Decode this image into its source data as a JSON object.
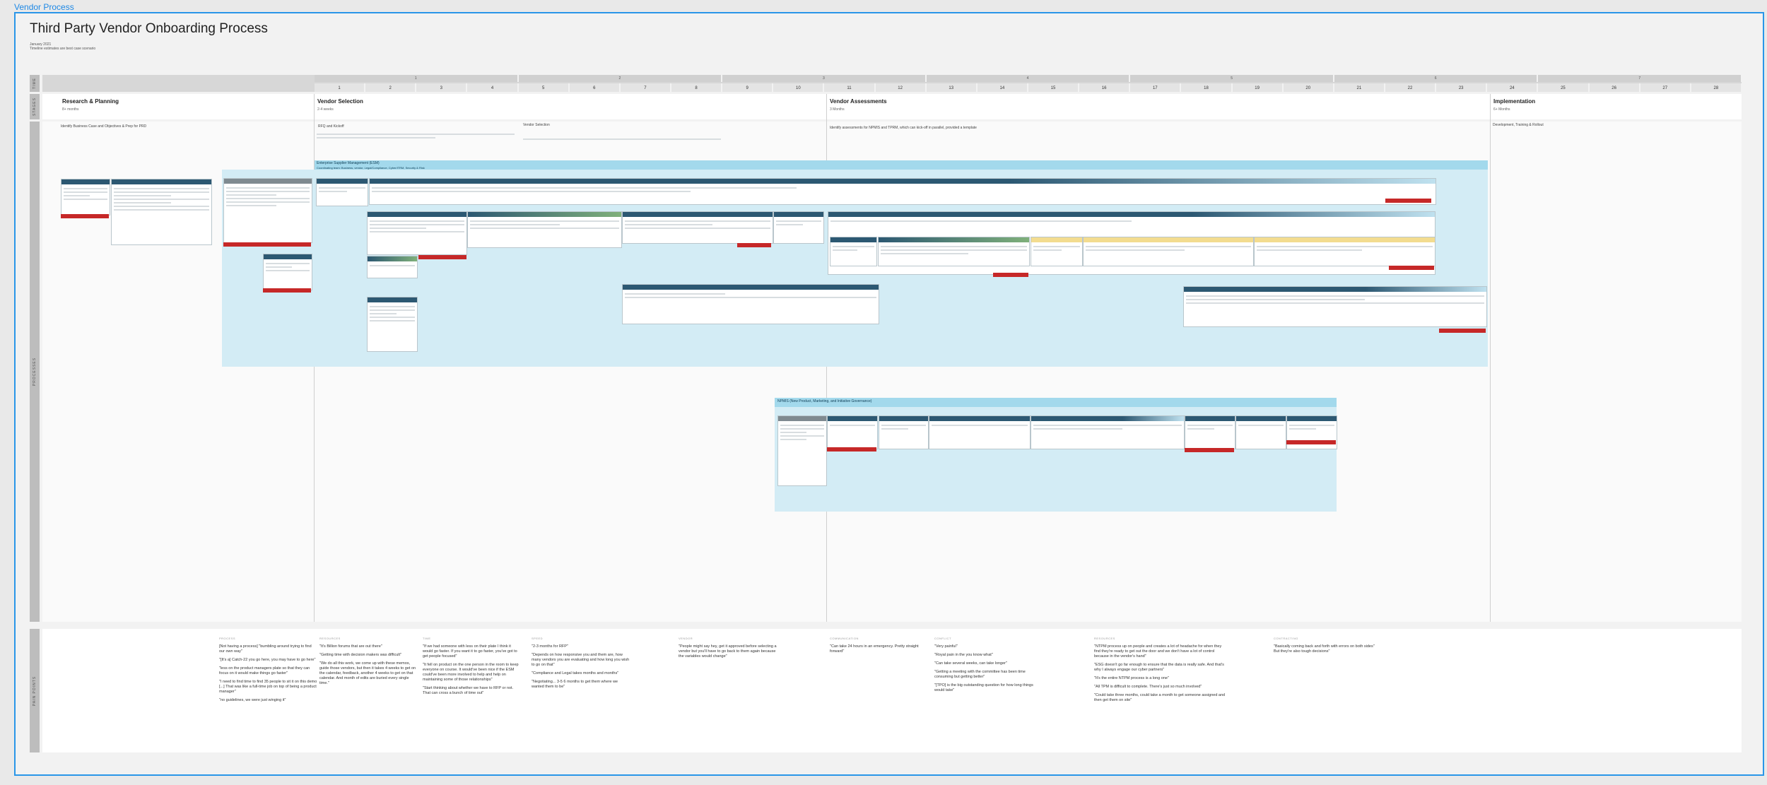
{
  "frame_label": "Vendor Process",
  "board": {
    "title": "Third Party Vendor Onboarding Process",
    "date": "January 2021",
    "meta": "Timeline estimates are best case scenario"
  },
  "rails": [
    "TIME",
    "STAGES",
    "PROCESSES",
    "PAIN POINTS"
  ],
  "time": {
    "months": [
      "1",
      "2",
      "3",
      "4",
      "5",
      "6",
      "7"
    ],
    "weeks": [
      "1",
      "2",
      "3",
      "4",
      "5",
      "6",
      "7",
      "8",
      "9",
      "10",
      "11",
      "12",
      "13",
      "14",
      "15",
      "16",
      "17",
      "18",
      "19",
      "20",
      "21",
      "22",
      "23",
      "24",
      "25",
      "26",
      "27",
      "28"
    ]
  },
  "stages": [
    {
      "name": "Research & Planning",
      "duration": "8+ months"
    },
    {
      "name": "Vendor Selection",
      "duration": "2-4 weeks"
    },
    {
      "name": "Vendor Assessments",
      "duration": "3 Months"
    },
    {
      "name": "Implementation",
      "duration": "6+ Months"
    }
  ],
  "processes": {
    "research": "Identify Business Case and Objectives & Prep for PRD",
    "rfq": "RFQ and Kickoff",
    "vendor_selection": "Vendor Selection",
    "assessments": "Identify assessments for NPMIS and TPRM, which can kick-off in parallel, provided a template",
    "implementation": "Development, Training & Rollout"
  },
  "swimlanes": {
    "esm": "Enterprise Supplier Management (ESM)",
    "esm_sub": "Coordinating team: Business, vendor, Legal/Compliance, Cyber/ITRM, Security & Risk",
    "npmis": "NPMIS (New Product, Marketing, and Initiative Governance)"
  },
  "quote_categories": [
    "PROCESS",
    "RESOURCES",
    "TIME",
    "SPEED",
    "VENDOR",
    "COMMUNICATION",
    "CONFLICT",
    "RESOURCES",
    "CONTRACTING"
  ],
  "quotes": [
    {
      "group": 0,
      "lines": [
        "[Not having a process] \"bumbling around trying to find our own way\"",
        "\"[It's a] Catch-22 you go here, you may have to go here\"",
        "\"less on the product managers plate so that they can focus on it would make things go faster\"",
        "\"I need to find time to find 35 people to sit it on this demo [...] That was like a full-time job on top of being a product manager\"",
        "\"no guidelines, we were just winging it\""
      ]
    },
    {
      "group": 1,
      "lines": [
        "\"It's Billion forums that are out there\"",
        "\"Getting time with decision makers was difficult\"",
        "\"We do all this work, we come up with these memos, guide those vendors, but then it takes 4 weeks to get on the calendar, feedback, another 4 weeks to get on that calendar. And month of edits are buried every single time.\""
      ]
    },
    {
      "group": 2,
      "lines": [
        "\"If we had someone with less on their plate I think it would go faster. If you want it to go faster, you've got to get people focused\"",
        "\"It fell on product on the one person in the room to keep everyone on course. It would've been nice if the ESM could've been more involved to help and help on maintaining some of those relationships\"",
        "\"Start thinking about whether we have to RFP or not. That can cross a bunch of time out\""
      ]
    },
    {
      "group": 3,
      "lines": [
        "\"2-3 months for RFP\"",
        "\"Depends on how responsive you and them are, how many vendors you are evaluating and how long you wish to go on that\"",
        "\"Compliance and Legal takes months and months\"",
        "\"Negotiating... 3-5 6 months to get them where we wanted them to be\""
      ]
    },
    {
      "group": 4,
      "lines": [
        "\"People might say hey, get it approved before selecting a vendor but you'll have to go back to them again because the variables would change\""
      ]
    },
    {
      "group": 5,
      "lines": [
        "\"Can take 24 hours in an emergency. Pretty straight forward\""
      ]
    },
    {
      "group": 6,
      "lines": [
        "\"Very painful\"",
        "\"Royal pain in the you know what\"",
        "\"Can take several weeks, can take longer\"",
        "\"Getting a meeting with the committee has been time consuming but getting better\"",
        "\"[TPO] is the big outstanding question for how long things would take\""
      ]
    },
    {
      "group": 7,
      "lines": [
        "\"NTPM process up on people and creates a lot of headache for when they find they're ready to get out the door and we don't have a lot of control because in the vendor's hand\"",
        "\"ESG doesn't go far enough to ensure that the data is really safe. And that's why I always engage our cyber partners\"",
        "\"It's the entire NTPM process is a long one\"",
        "\"All TPM is difficult to complete. There's just so much involved\"",
        "\"Could take three months, could take a month to get someone assigned and then get them on site\""
      ]
    },
    {
      "group": 8,
      "lines": [
        "\"Basically coming back and forth with errors on both sides\" But they're also tough decisions\""
      ]
    }
  ]
}
